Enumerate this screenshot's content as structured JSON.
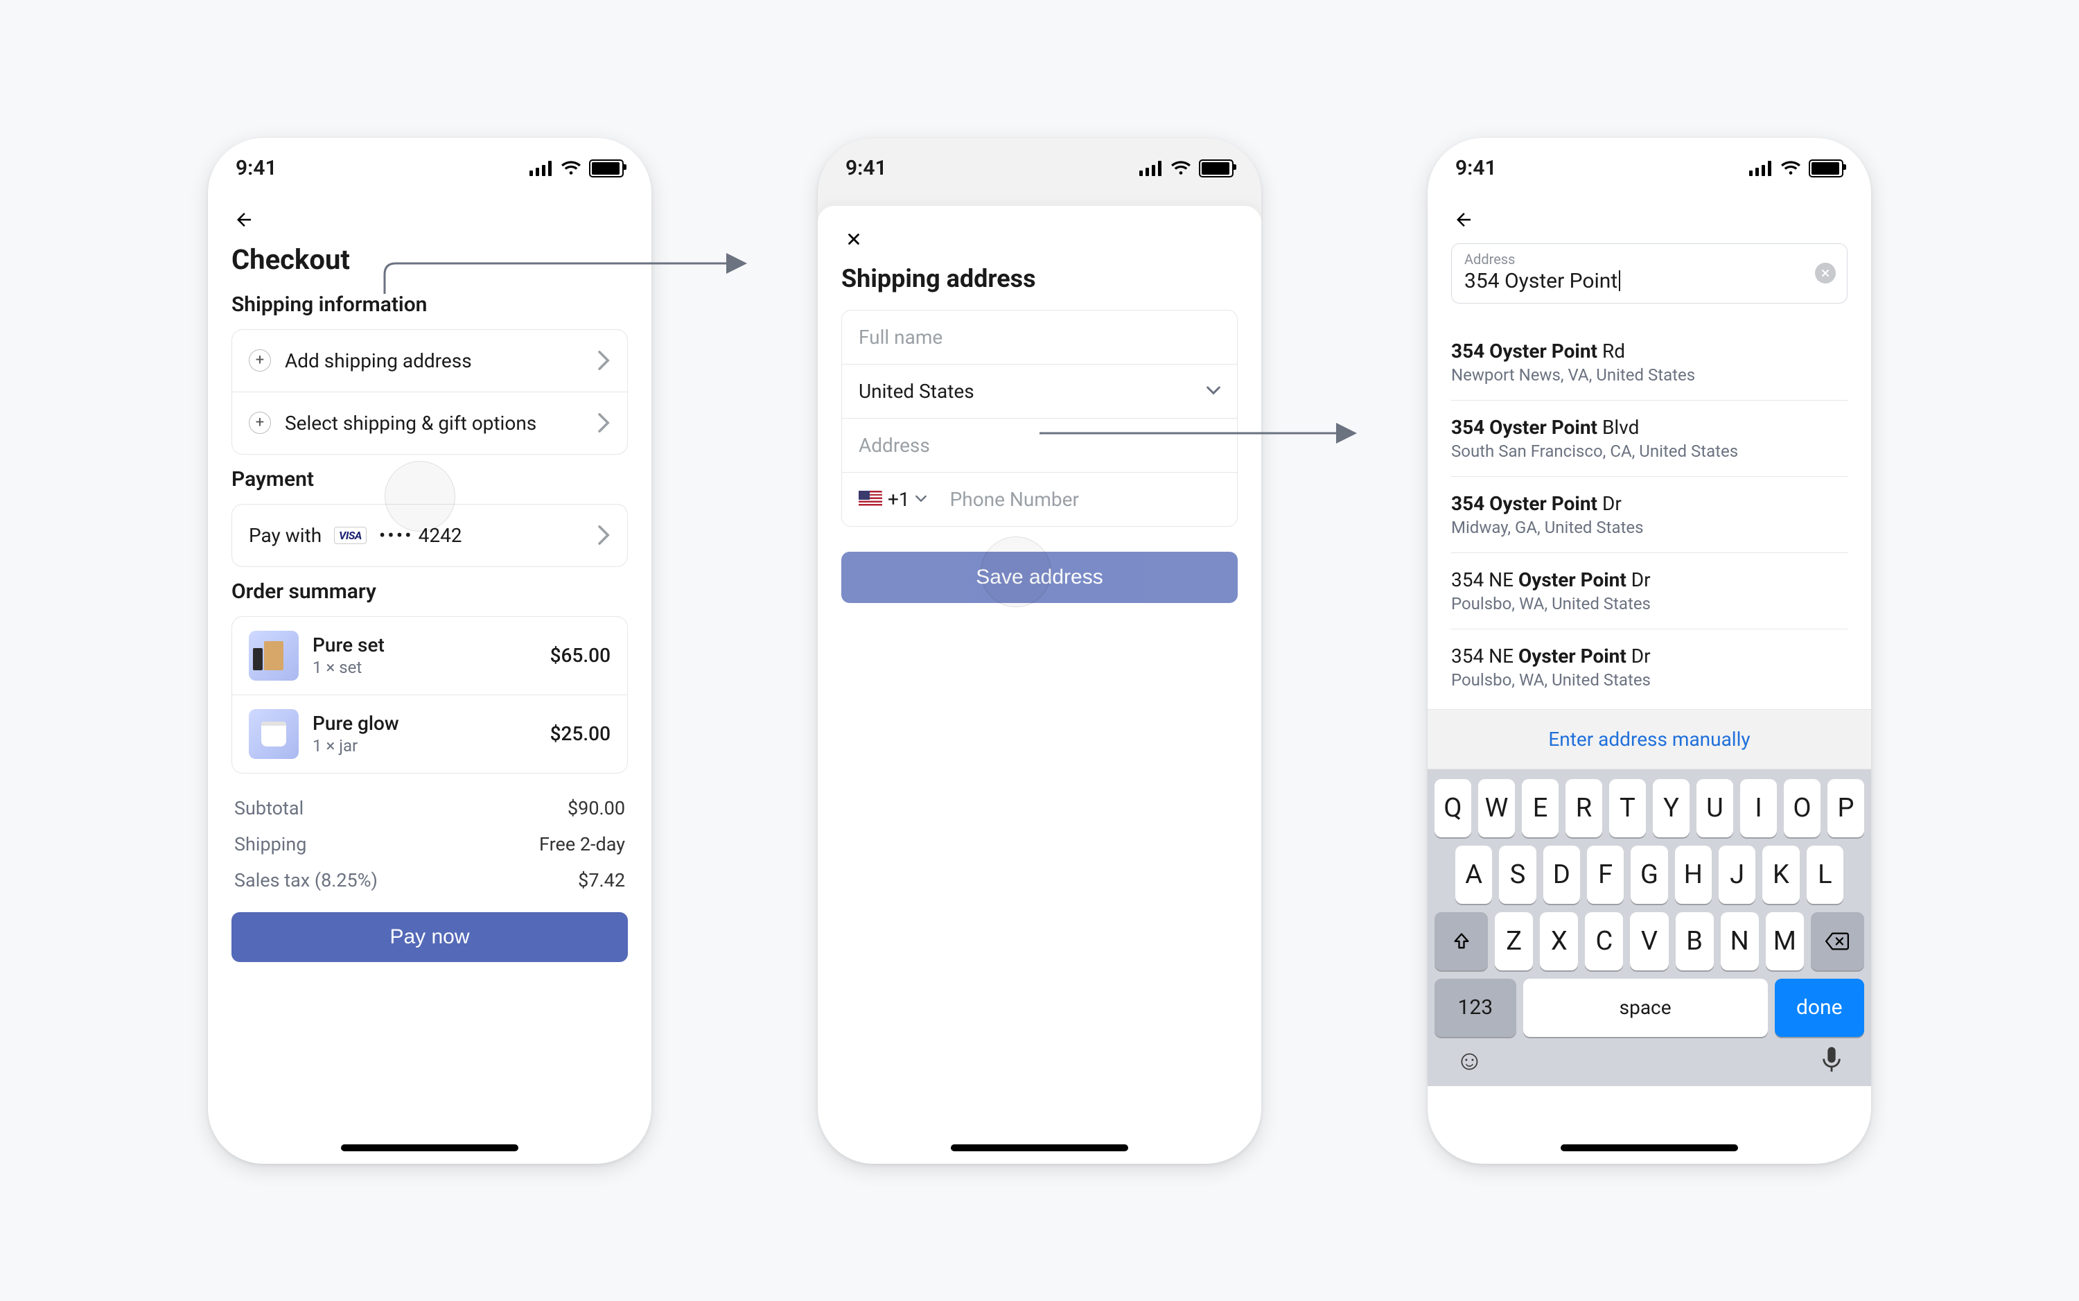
{
  "status_time": "9:41",
  "screen1": {
    "title": "Checkout",
    "shipping_section": "Shipping information",
    "add_shipping": "Add shipping address",
    "select_shipping": "Select shipping & gift options",
    "payment_section": "Payment",
    "pay_with": "Pay with",
    "card_last4": "4242",
    "order_section": "Order summary",
    "items": [
      {
        "name": "Pure set",
        "qty": "1 × set",
        "price": "$65.00"
      },
      {
        "name": "Pure glow",
        "qty": "1 × jar",
        "price": "$25.00"
      }
    ],
    "subtotal_label": "Subtotal",
    "subtotal_val": "$90.00",
    "shipping_label": "Shipping",
    "shipping_val": "Free 2-day",
    "tax_label": "Sales tax (8.25%)",
    "tax_val": "$7.42",
    "pay_now": "Pay now"
  },
  "screen2": {
    "title": "Shipping address",
    "fullname_ph": "Full name",
    "country": "United States",
    "address_ph": "Address",
    "dial_code": "+1",
    "phone_ph": "Phone Number",
    "save": "Save address"
  },
  "screen3": {
    "field_label": "Address",
    "query": "354 Oyster Point",
    "results": [
      {
        "bold": "354 Oyster Point",
        "suffix": " Rd",
        "sub": "Newport News, VA, United States"
      },
      {
        "bold": "354 Oyster Point",
        "suffix": " Blvd",
        "sub": "South San Francisco, CA, United States"
      },
      {
        "bold": "354 Oyster Point",
        "suffix": " Dr",
        "sub": "Midway, GA, United States"
      },
      {
        "prefix": "354 NE ",
        "bold": "Oyster Point",
        "suffix": " Dr",
        "sub": "Poulsbo, WA, United States"
      },
      {
        "prefix": "354 NE ",
        "bold": "Oyster Point",
        "suffix": " Dr",
        "sub": "Poulsbo, WA, United States"
      }
    ],
    "manual": "Enter address manually"
  },
  "keyboard": {
    "rows": [
      [
        "Q",
        "W",
        "E",
        "R",
        "T",
        "Y",
        "U",
        "I",
        "O",
        "P"
      ],
      [
        "A",
        "S",
        "D",
        "F",
        "G",
        "H",
        "J",
        "K",
        "L"
      ],
      [
        "Z",
        "X",
        "C",
        "V",
        "B",
        "N",
        "M"
      ]
    ],
    "num": "123",
    "space": "space",
    "done": "done"
  }
}
